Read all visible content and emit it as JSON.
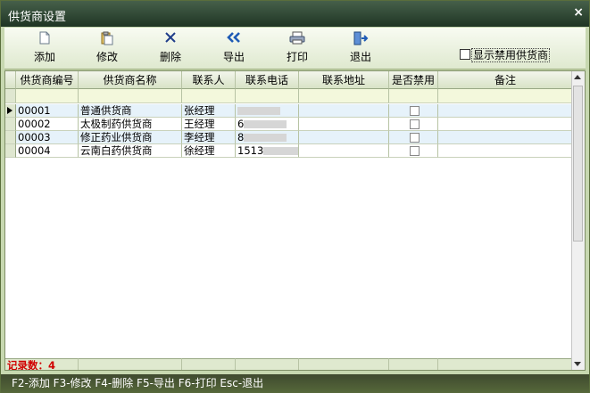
{
  "window": {
    "title": "供货商设置",
    "close_icon": "×"
  },
  "toolbar": {
    "buttons": [
      {
        "label": "添加",
        "icon": "page-icon"
      },
      {
        "label": "修改",
        "icon": "clipboard-icon"
      },
      {
        "label": "删除",
        "icon": "x-icon"
      },
      {
        "label": "导出",
        "icon": "double-arrow-left-icon"
      },
      {
        "label": "打印",
        "icon": "printer-icon"
      },
      {
        "label": "退出",
        "icon": "exit-door-icon"
      }
    ],
    "show_disabled_label": "显示禁用供货商",
    "show_disabled_checked": false
  },
  "grid": {
    "columns": [
      "供货商编号",
      "供货商名称",
      "联系人",
      "联系电话",
      "联系地址",
      "是否禁用",
      "备注"
    ],
    "rows": [
      {
        "id": "00001",
        "name": "普通供货商",
        "contact": "张经理",
        "phone": "",
        "address": "",
        "disabled": false,
        "note": ""
      },
      {
        "id": "00002",
        "name": "太极制药供货商",
        "contact": "王经理",
        "phone": "6",
        "address": "",
        "disabled": false,
        "note": ""
      },
      {
        "id": "00003",
        "name": "修正药业供货商",
        "contact": "李经理",
        "phone": "8",
        "address": "",
        "disabled": false,
        "note": ""
      },
      {
        "id": "00004",
        "name": "云南白药供货商",
        "contact": "徐经理",
        "phone": "1513",
        "address": "",
        "disabled": false,
        "note": ""
      }
    ],
    "record_count_label": "记录数：4"
  },
  "status": {
    "text": "F2-添加 F3-修改 F4-删除 F5-导出 F6-打印 Esc-退出"
  }
}
